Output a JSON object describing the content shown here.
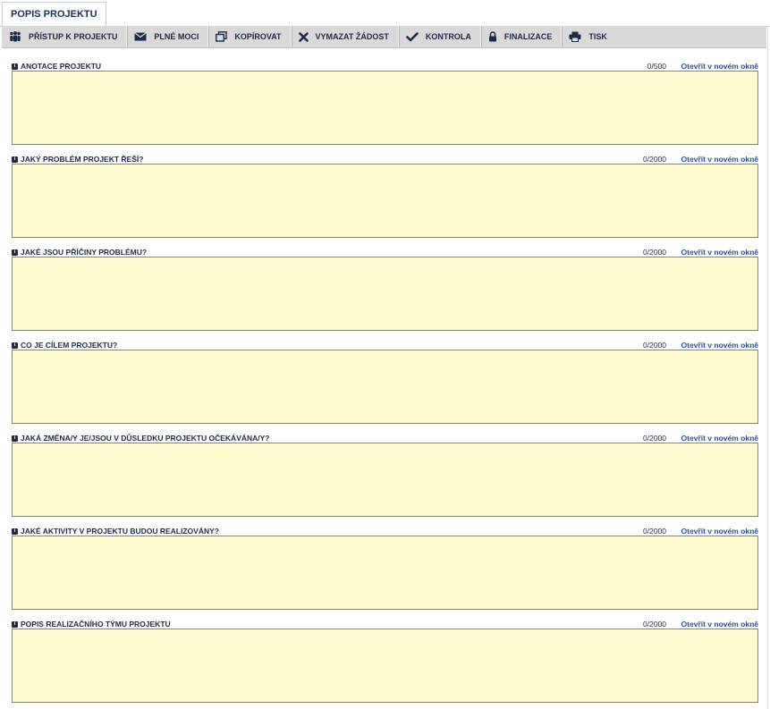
{
  "tab": {
    "label": "POPIS PROJEKTU"
  },
  "toolbar": {
    "buttons": [
      {
        "label": "PŘÍSTUP K PROJEKTU",
        "icon": "people-icon"
      },
      {
        "label": "PLNÉ MOCI",
        "icon": "envelope-icon"
      },
      {
        "label": "KOPÍROVAT",
        "icon": "copy-icon"
      },
      {
        "label": "VYMAZAT ŽÁDOST",
        "icon": "x-icon"
      },
      {
        "label": "KONTROLA",
        "icon": "checkmark-icon"
      },
      {
        "label": "FINALIZACE",
        "icon": "lock-icon"
      },
      {
        "label": "TISK",
        "icon": "printer-icon"
      }
    ]
  },
  "fields": [
    {
      "label": "ANOTACE PROJEKTU",
      "counter": "0/500",
      "link": "Otevřít v novém okně",
      "value": ""
    },
    {
      "label": "JAKÝ PROBLÉM PROJEKT ŘEŠÍ?",
      "counter": "0/2000",
      "link": "Otevřít v novém okně",
      "value": ""
    },
    {
      "label": "JAKÉ JSOU PŘÍČINY PROBLÉMU?",
      "counter": "0/2000",
      "link": "Otevřít v novém okně",
      "value": ""
    },
    {
      "label": "CO JE CÍLEM PROJEKTU?",
      "counter": "0/2000",
      "link": "Otevřít v novém okně",
      "value": ""
    },
    {
      "label": "JAKÁ ZMĚNA/Y JE/JSOU V DŮSLEDKU PROJEKTU OČEKÁVÁNA/Y?",
      "counter": "0/2000",
      "link": "Otevřít v novém okně",
      "value": ""
    },
    {
      "label": "JAKÉ AKTIVITY V PROJEKTU BUDOU REALIZOVÁNY?",
      "counter": "0/2000",
      "link": "Otevřít v novém okně",
      "value": ""
    },
    {
      "label": "POPIS REALIZAČNÍHO TÝMU PROJEKTU",
      "counter": "0/2000",
      "link": "Otevřít v novém okně",
      "value": ""
    }
  ],
  "colors": {
    "field_bg": "#fffbcc",
    "toolbar_bg": "#d9d9d9",
    "text": "#1c2b4a",
    "link": "#2a4f9a"
  }
}
